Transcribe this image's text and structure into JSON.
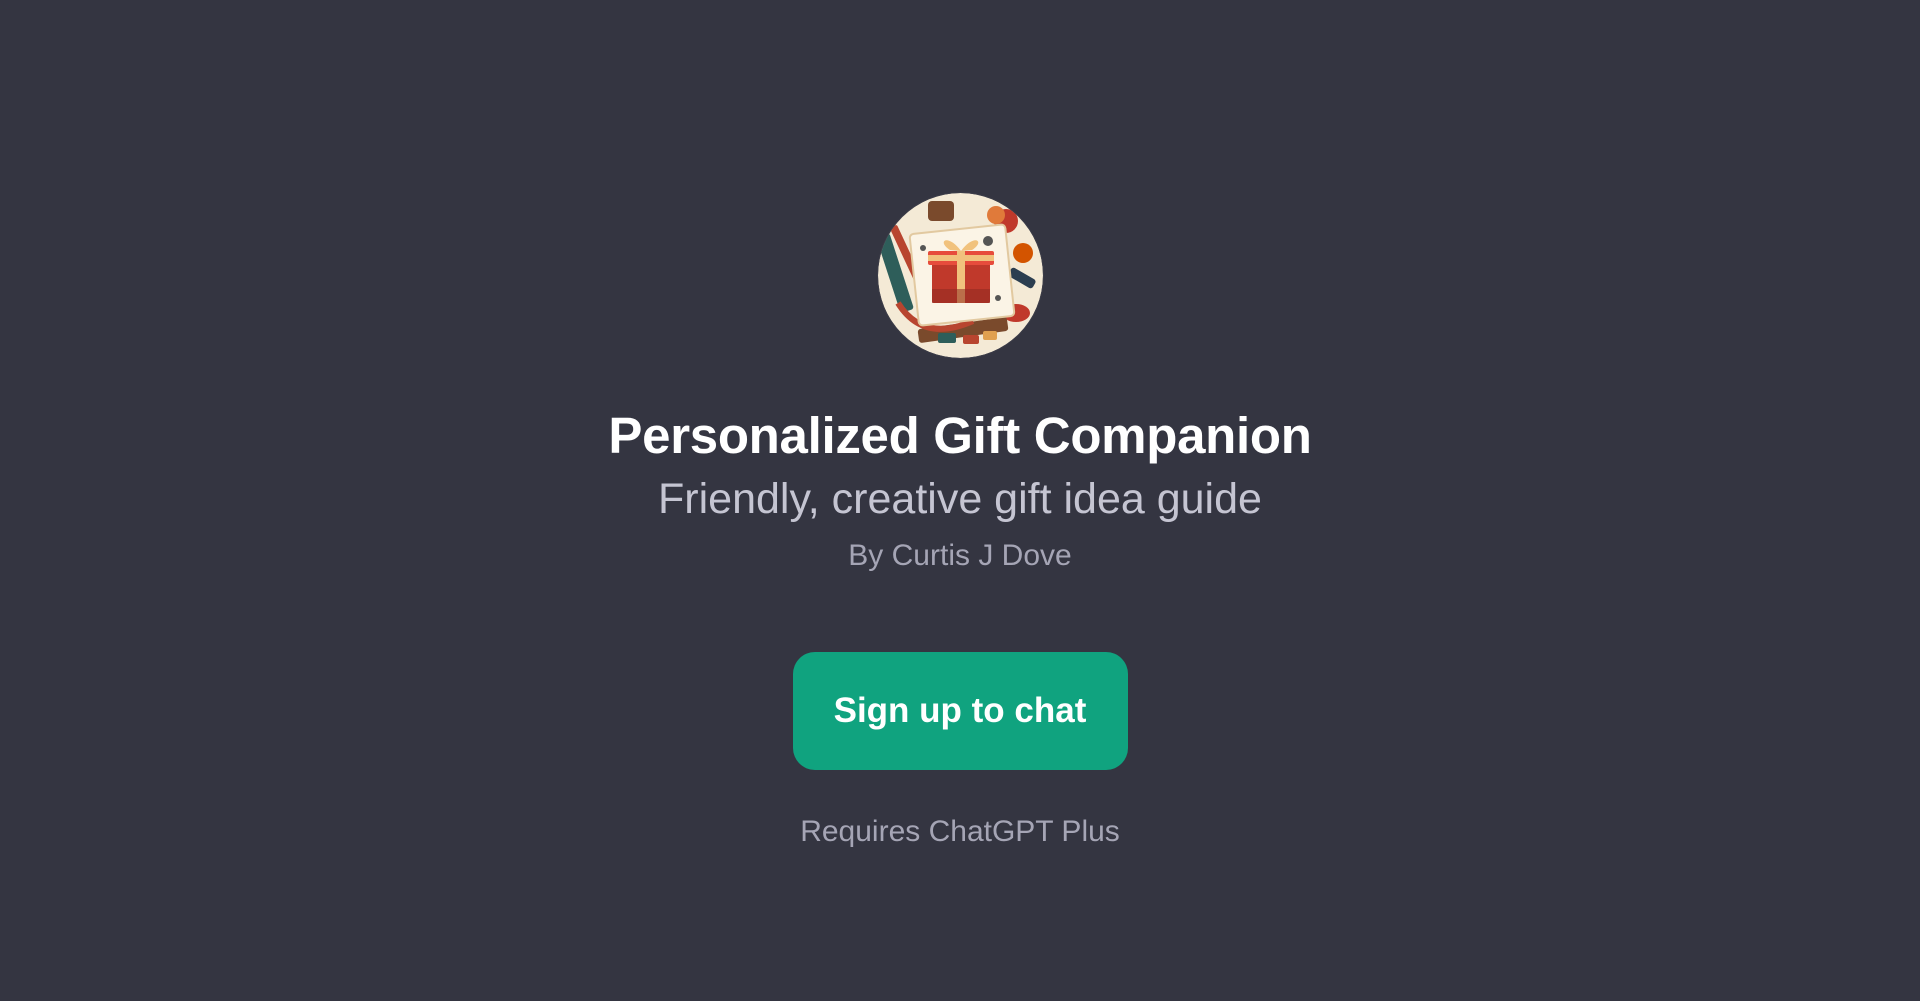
{
  "gpt": {
    "avatar_icon": "gift-box-illustration-icon",
    "title": "Personalized Gift Companion",
    "description": "Friendly, creative gift idea guide",
    "author": "By Curtis J Dove"
  },
  "actions": {
    "signup_label": "Sign up to chat",
    "requirement_note": "Requires ChatGPT Plus"
  },
  "colors": {
    "background": "#343541",
    "accent": "#10a37f",
    "title": "#ffffff",
    "subtitle": "#c5c5d2",
    "muted": "#a5a5b5"
  }
}
